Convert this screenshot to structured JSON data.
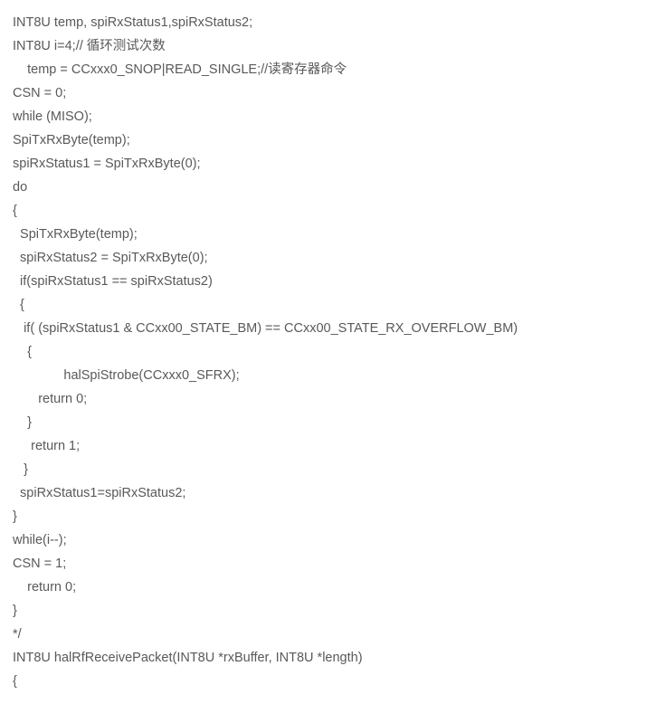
{
  "lines": [
    "INT8U temp, spiRxStatus1,spiRxStatus2;",
    "INT8U i=4;// 循环测试次数",
    "    temp = CCxxx0_SNOP|READ_SINGLE;//读寄存器命令",
    "CSN = 0;",
    "while (MISO);",
    "SpiTxRxByte(temp);",
    "spiRxStatus1 = SpiTxRxByte(0);",
    "do",
    "{",
    "  SpiTxRxByte(temp);",
    "  spiRxStatus2 = SpiTxRxByte(0);",
    "  if(spiRxStatus1 == spiRxStatus2)",
    "  {",
    "   if( (spiRxStatus1 & CCxx00_STATE_BM) == CCxx00_STATE_RX_OVERFLOW_BM)",
    "    {",
    "              halSpiStrobe(CCxxx0_SFRX);",
    "       return 0;",
    "    }",
    "     return 1;",
    "   }",
    "  spiRxStatus1=spiRxStatus2;",
    "}",
    "while(i--);",
    "CSN = 1;",
    "    return 0;",
    "}",
    "*/",
    "INT8U halRfReceivePacket(INT8U *rxBuffer, INT8U *length)",
    "{"
  ]
}
